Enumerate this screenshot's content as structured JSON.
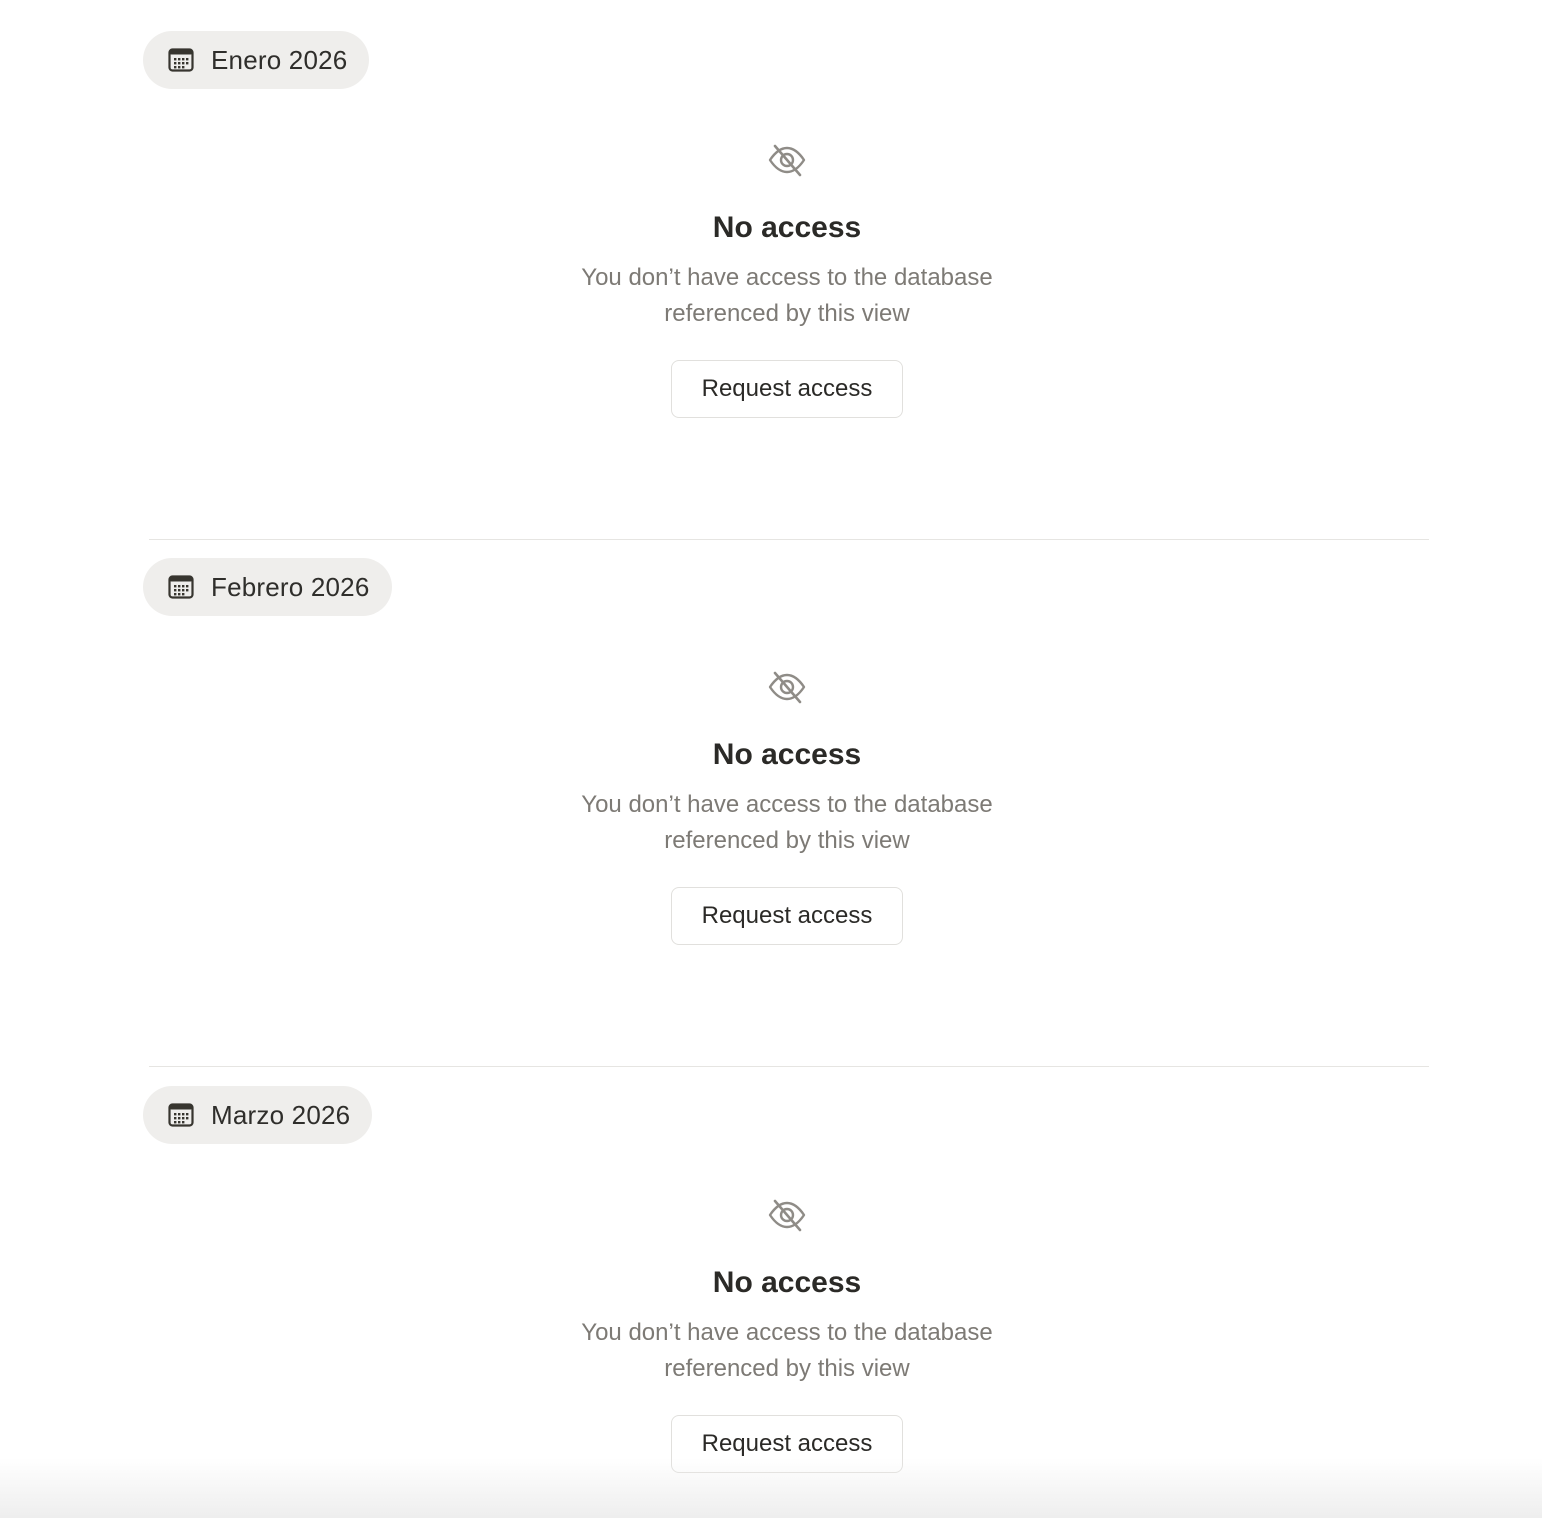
{
  "sections": [
    {
      "chip_label": "Enero 2026",
      "chip_icon": "calendar-icon",
      "status_icon": "eye-off-icon",
      "title": "No access",
      "description": "You don’t have access to the database referenced by this view",
      "button_label": "Request access"
    },
    {
      "chip_label": "Febrero 2026",
      "chip_icon": "calendar-icon",
      "status_icon": "eye-off-icon",
      "title": "No access",
      "description": "You don’t have access to the database referenced by this view",
      "button_label": "Request access"
    },
    {
      "chip_label": "Marzo 2026",
      "chip_icon": "calendar-icon",
      "status_icon": "eye-off-icon",
      "title": "No access",
      "description": "You don’t have access to the database referenced by this view",
      "button_label": "Request access"
    }
  ],
  "colors": {
    "chip_background": "#efeeec",
    "title": "#2b2a27",
    "description": "#7d7a75",
    "divider": "#e6e5e2"
  }
}
